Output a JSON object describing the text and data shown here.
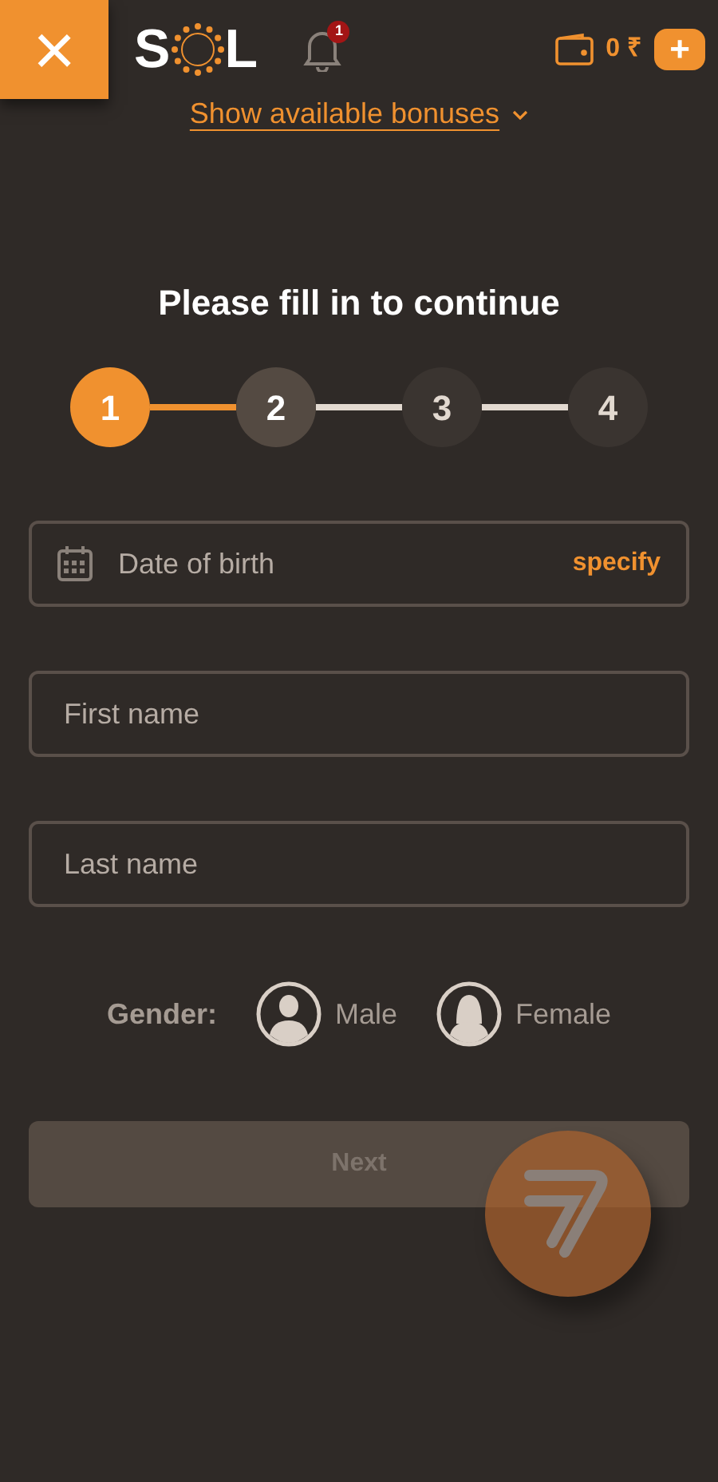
{
  "header": {
    "logo": {
      "left": "S",
      "right": "L"
    },
    "notifications": {
      "count": "1"
    },
    "balance": "0 ₹",
    "add_button": "+",
    "close_button": "×"
  },
  "bonuses_link": "Show available bonuses",
  "title": "Please fill in to continue",
  "steps": [
    {
      "label": "1",
      "selected": true,
      "enabled": true
    },
    {
      "label": "2",
      "selected": false,
      "enabled": true
    },
    {
      "label": "3",
      "selected": false,
      "enabled": false
    },
    {
      "label": "4",
      "selected": false,
      "enabled": false
    }
  ],
  "fields": [
    {
      "kind": "date",
      "placeholder": "Date of birth",
      "action": "specify"
    },
    {
      "kind": "text",
      "placeholder": "First name"
    },
    {
      "kind": "text",
      "placeholder": "Last name"
    }
  ],
  "gender": {
    "label": "Gender:",
    "options": [
      {
        "kind": "male",
        "label": "Male",
        "selected": false
      },
      {
        "kind": "female",
        "label": "Female",
        "selected": false
      }
    ]
  },
  "next_button": {
    "label": "Next",
    "disabled": true
  }
}
